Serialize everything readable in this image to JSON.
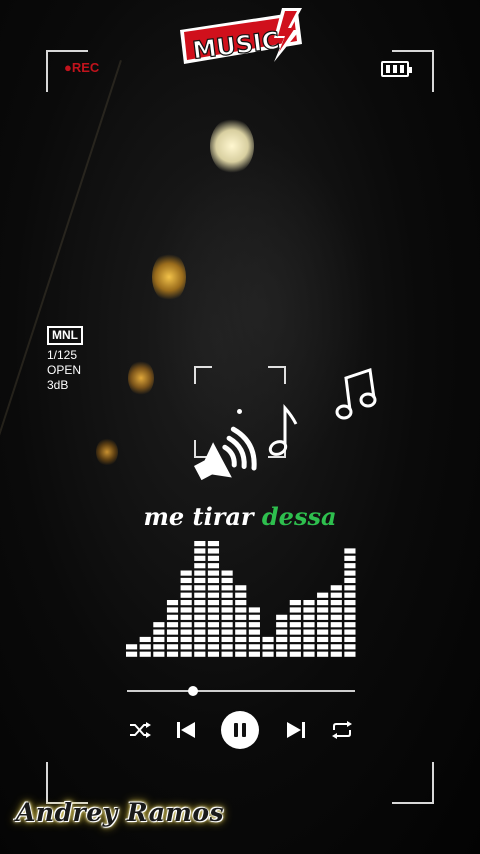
{
  "app": {
    "logo_text": "MUSIC"
  },
  "hud": {
    "rec_label": "●REC",
    "battery_level": 1.0,
    "mode_label": "MNL",
    "shutter": "1/125",
    "aperture": "OPEN",
    "gain": "3dB"
  },
  "lyrics": {
    "current_word_white": "me tirar",
    "current_word_highlight": "dessa"
  },
  "visualizer": {
    "max_segments": 16,
    "levels": [
      2,
      3,
      5,
      8,
      12,
      16,
      16,
      12,
      10,
      7,
      3,
      6,
      8,
      8,
      9,
      10,
      15
    ]
  },
  "player": {
    "progress": 0.29,
    "shuffle_icon": "shuffle-icon",
    "prev_icon": "skip-previous-icon",
    "play_pause_icon": "pause-icon",
    "next_icon": "skip-next-icon",
    "repeat_icon": "repeat-icon"
  },
  "credit": {
    "author": "Andrey Ramos"
  },
  "colors": {
    "accent_green": "#2ebf4e",
    "rec_red": "#c1131c",
    "logo_red": "#d0101c"
  }
}
